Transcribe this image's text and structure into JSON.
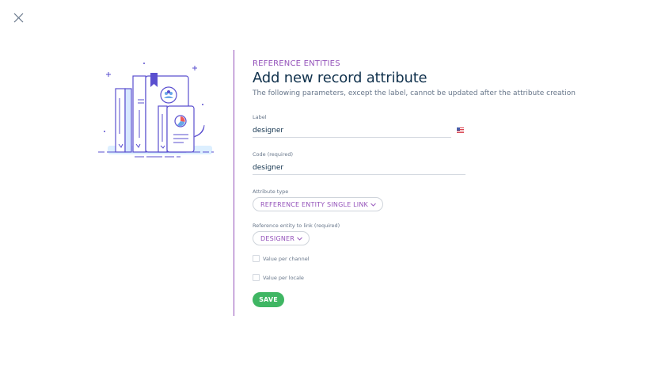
{
  "modal": {
    "close_icon": "close-icon",
    "illustration_icon": "reference-entities-illustration"
  },
  "header": {
    "eyebrow": "REFERENCE ENTITIES",
    "title": "Add new record attribute",
    "subtitle": "The following parameters, except the label, cannot be updated after the attribute creation"
  },
  "form": {
    "label_field": {
      "label": "Label",
      "value": "designer",
      "locale_flag": "us-flag-icon"
    },
    "code_field": {
      "label": "Code (required)",
      "value": "designer"
    },
    "attribute_type": {
      "label": "Attribute type",
      "value": "REFERENCE ENTITY SINGLE LINK"
    },
    "reference_entity": {
      "label": "Reference entity to link (required)",
      "value": "DESIGNER"
    },
    "value_per_channel": {
      "label": "Value per channel",
      "checked": false
    },
    "value_per_locale": {
      "label": "Value per locale",
      "checked": false
    },
    "save_label": "SAVE"
  },
  "colors": {
    "accent": "#9452ba",
    "primary_text": "#11324d",
    "secondary_text": "#67768a",
    "save_button": "#3fb663"
  }
}
